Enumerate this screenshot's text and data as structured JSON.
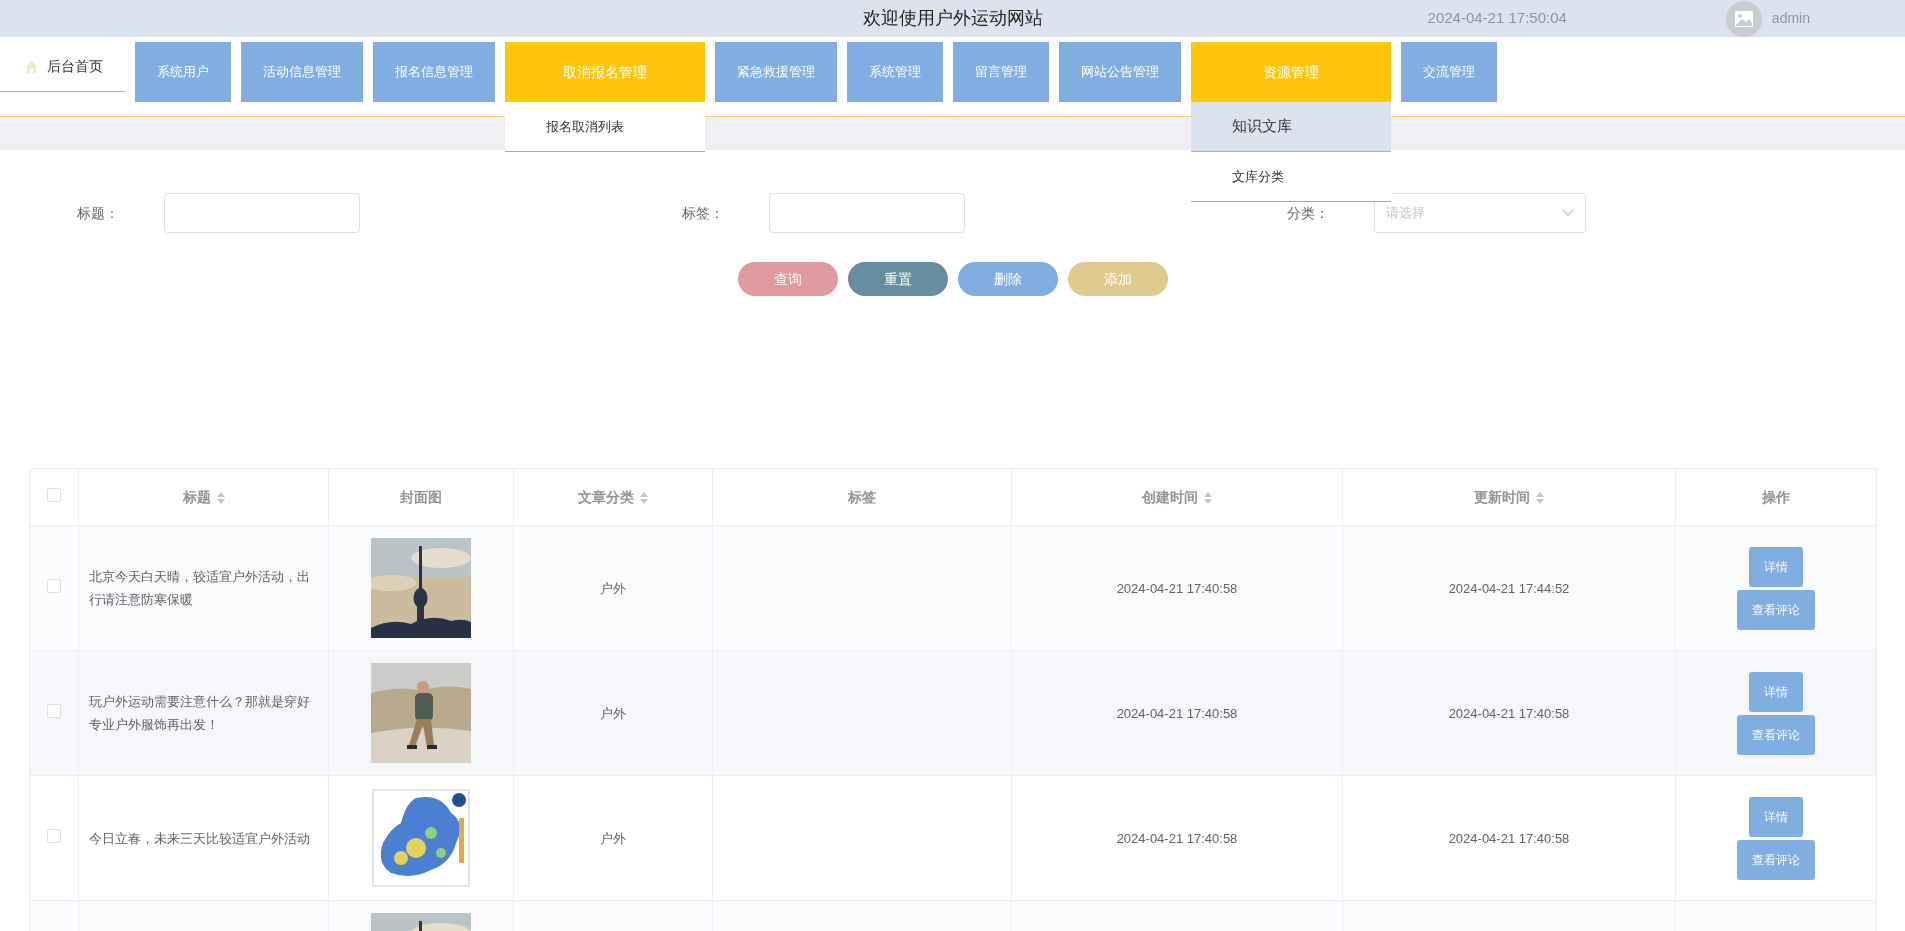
{
  "header": {
    "title": "欢迎使用户外运动网站",
    "time": "2024-04-21 17:50:04",
    "user": "admin"
  },
  "nav": [
    {
      "label": "后台首页",
      "kind": "home",
      "selected": false
    },
    {
      "label": "系统用户",
      "kind": "menu",
      "selected": false
    },
    {
      "label": "活动信息管理",
      "kind": "menu",
      "selected": false
    },
    {
      "label": "报名信息管理",
      "kind": "menu",
      "selected": false
    },
    {
      "label": "取消报名管理",
      "kind": "menu",
      "selected": true,
      "dropdown": [
        {
          "label": "报名取消列表",
          "selected": false
        }
      ]
    },
    {
      "label": "紧急救援管理",
      "kind": "menu",
      "selected": false
    },
    {
      "label": "系统管理",
      "kind": "menu",
      "selected": false
    },
    {
      "label": "留言管理",
      "kind": "menu",
      "selected": false
    },
    {
      "label": "网站公告管理",
      "kind": "menu",
      "selected": false
    },
    {
      "label": "资源管理",
      "kind": "menu",
      "selected": true,
      "dropdown": [
        {
          "label": "知识文库",
          "selected": true
        },
        {
          "label": "文库分类",
          "selected": false
        }
      ]
    },
    {
      "label": "交流管理",
      "kind": "menu",
      "selected": false
    }
  ],
  "filters": [
    {
      "label": "标题：",
      "kind": "text"
    },
    {
      "label": "标签：",
      "kind": "text"
    },
    {
      "label": "分类：",
      "kind": "select",
      "placeholder": "请选择"
    }
  ],
  "buttons": [
    {
      "label": "查询",
      "color": "#e0999e"
    },
    {
      "label": "重置",
      "color": "#678ea0"
    },
    {
      "label": "删除",
      "color": "#80aee0"
    },
    {
      "label": "添加",
      "color": "#dfca8e"
    }
  ],
  "table": {
    "columns": [
      {
        "kind": "checkbox",
        "checked": false
      },
      {
        "label": "标题",
        "sortable": true
      },
      {
        "label": "封面图",
        "sortable": false
      },
      {
        "label": "文章分类",
        "sortable": true
      },
      {
        "label": "标签",
        "sortable": false
      },
      {
        "label": "创建时间",
        "sortable": true
      },
      {
        "label": "更新时间",
        "sortable": true
      },
      {
        "label": "操作",
        "sortable": false
      }
    ],
    "rows": [
      {
        "checked": false,
        "title": "北京今天白天晴，较适宜户外活动，出行请注意防寒保暖",
        "cover": {
          "kind": "picture"
        },
        "category": "户外",
        "created": "2024-04-21 17:40:58",
        "updated": "2024-04-21 17:44:52",
        "actions": [
          "详情",
          "查看评论"
        ]
      },
      {
        "checked": false,
        "title": "玩户外运动需要注意什么？那就是穿好专业户外服饰再出发！",
        "cover": {
          "kind": "picture"
        },
        "category": "户外",
        "created": "2024-04-21 17:40:58",
        "updated": "2024-04-21 17:40:58",
        "actions": [
          "详情",
          "查看评论"
        ]
      },
      {
        "checked": false,
        "title": "今日立春，未来三天比较适宜户外活动",
        "cover": {
          "kind": "picture"
        },
        "category": "户外",
        "created": "2024-04-21 17:40:58",
        "updated": "2024-04-21 17:40:58",
        "actions": [
          "详情",
          "查看评论"
        ]
      },
      {
        "cover": {
          "kind": "picture"
        }
      }
    ]
  }
}
